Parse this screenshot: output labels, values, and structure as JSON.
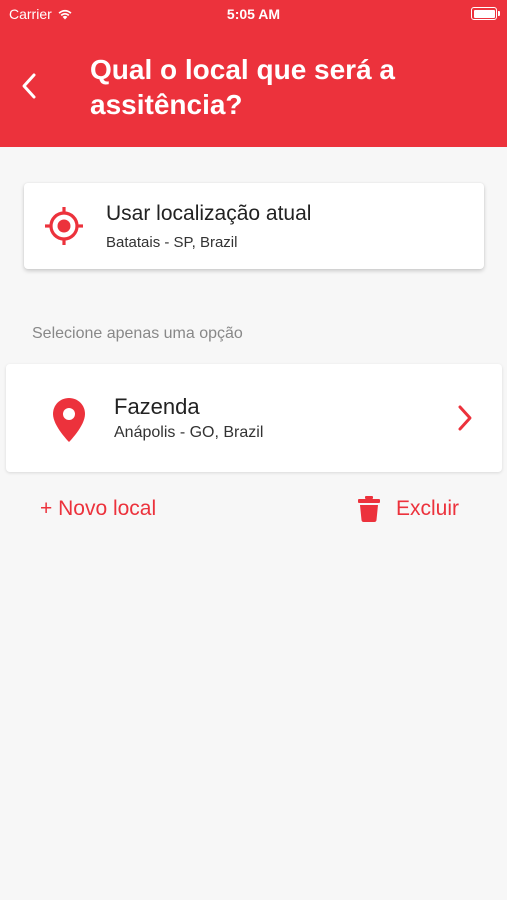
{
  "status_bar": {
    "carrier": "Carrier",
    "time": "5:05 AM"
  },
  "header": {
    "title": "Qual o local que será a assitência?"
  },
  "current_location": {
    "title": "Usar localização atual",
    "subtitle": "Batatais - SP, Brazil"
  },
  "hint": "Selecione apenas uma opção",
  "places": [
    {
      "name": "Fazenda",
      "address": "Anápolis - GO, Brazil"
    }
  ],
  "actions": {
    "new_label": "+ Novo local",
    "delete_label": "Excluir"
  },
  "colors": {
    "accent": "#ec323c",
    "background": "#f7f7f7"
  },
  "icons": {
    "back": "chevron-left-icon",
    "current": "target-icon",
    "place": "map-pin-icon",
    "chevron": "chevron-right-icon",
    "delete": "trash-icon",
    "wifi": "wifi-icon",
    "battery": "battery-icon"
  }
}
